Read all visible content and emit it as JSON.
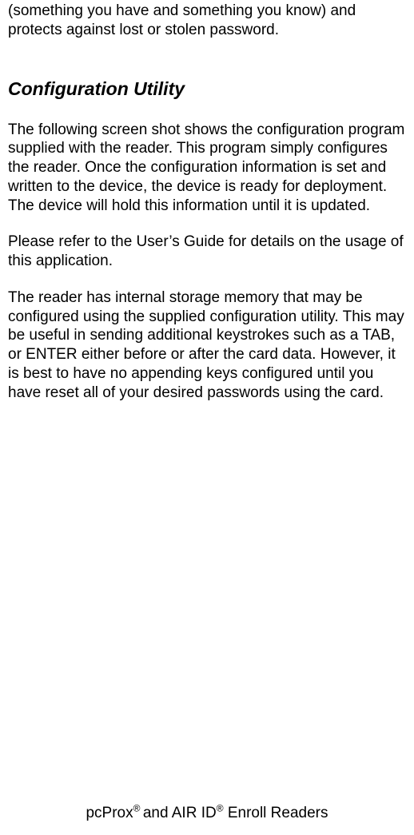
{
  "intro_fragment": "(something you have and something you know) and protects against lost or stolen password.",
  "heading": "Configuration Utility",
  "para1": "The following screen shot shows the configuration program supplied with the reader.  This program simply configures the reader.  Once the configuration information is set and written to the device, the device is ready for deployment.  The device will hold this information until it is updated.",
  "para2": "Please refer to the User’s Guide for details on the usage of this application.",
  "para3": "The reader has internal storage memory that may be configured using the supplied configuration utility.  This may be useful in sending additional keystrokes such as a TAB, or ENTER either before or after the card data.  However, it is best to have no appending keys configured until you have reset all of your desired passwords using the card.",
  "footer": {
    "part1": "pcProx",
    "sup1": "® ",
    "part2": "and AIR ID",
    "sup2": "®",
    "part3": " Enroll Readers"
  }
}
